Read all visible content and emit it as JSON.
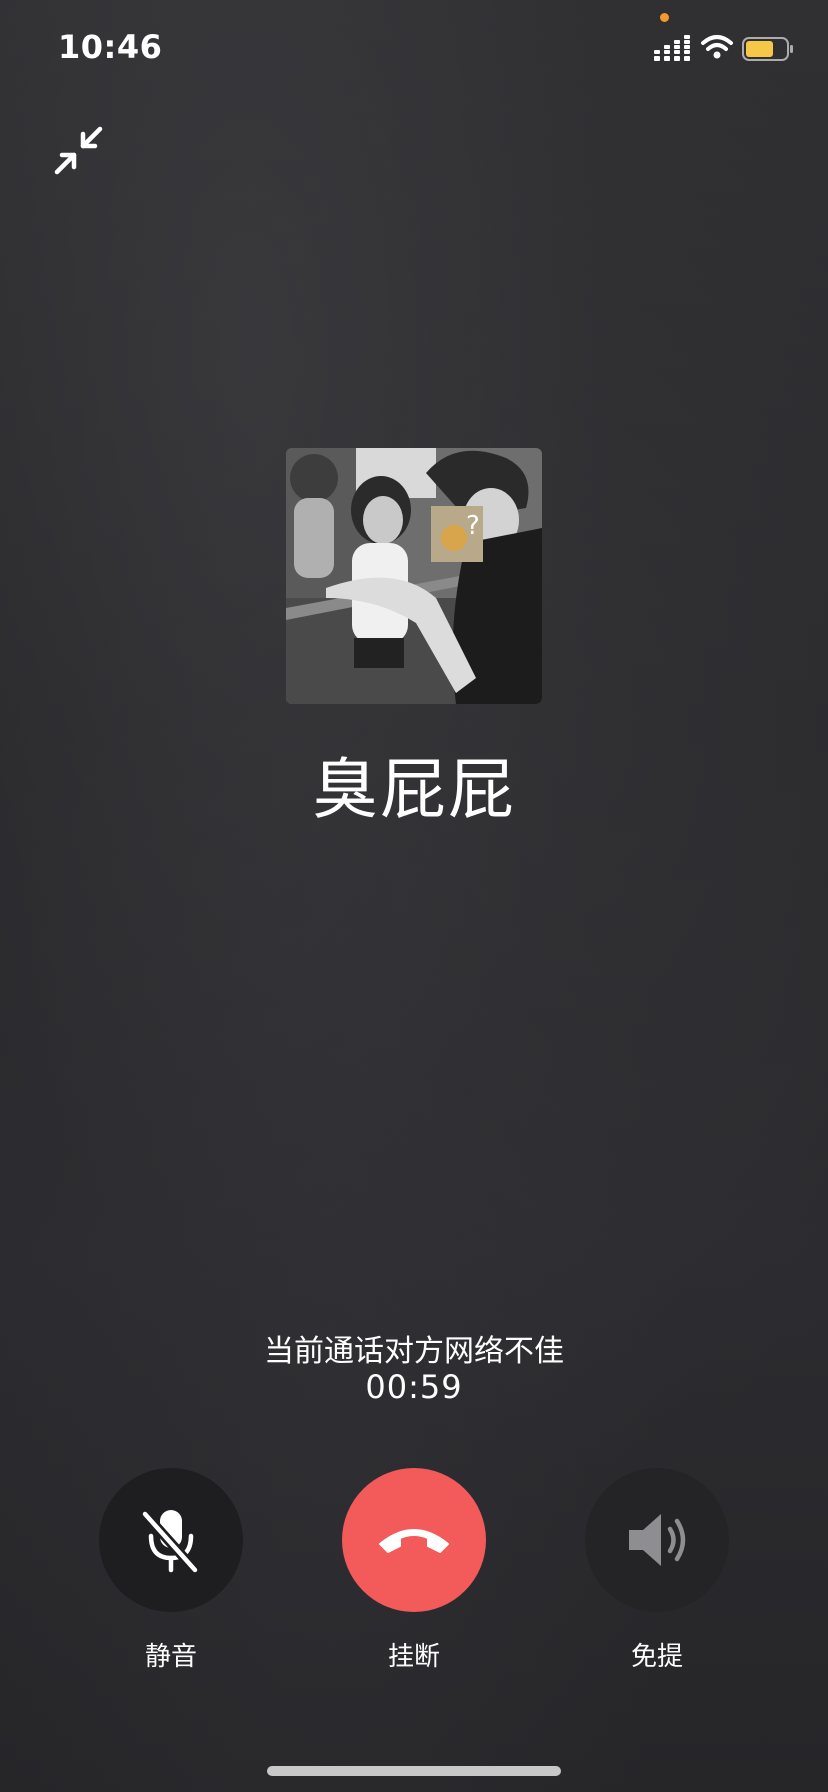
{
  "status_bar": {
    "time": "10:46"
  },
  "caller": {
    "name": "臭屁屁"
  },
  "call": {
    "network_warning": "当前通话对方网络不佳",
    "timer": "00:59"
  },
  "controls": {
    "mute_label": "静音",
    "hangup_label": "挂断",
    "speaker_label": "免提"
  },
  "icons": {
    "minimize": "minimize-icon",
    "mute": "microphone-off-icon",
    "hangup": "phone-hangup-icon",
    "speaker": "speaker-icon"
  },
  "colors": {
    "hangup": "#f35a5a",
    "battery": "#f5c84a",
    "recording_dot": "#f39a2e"
  }
}
